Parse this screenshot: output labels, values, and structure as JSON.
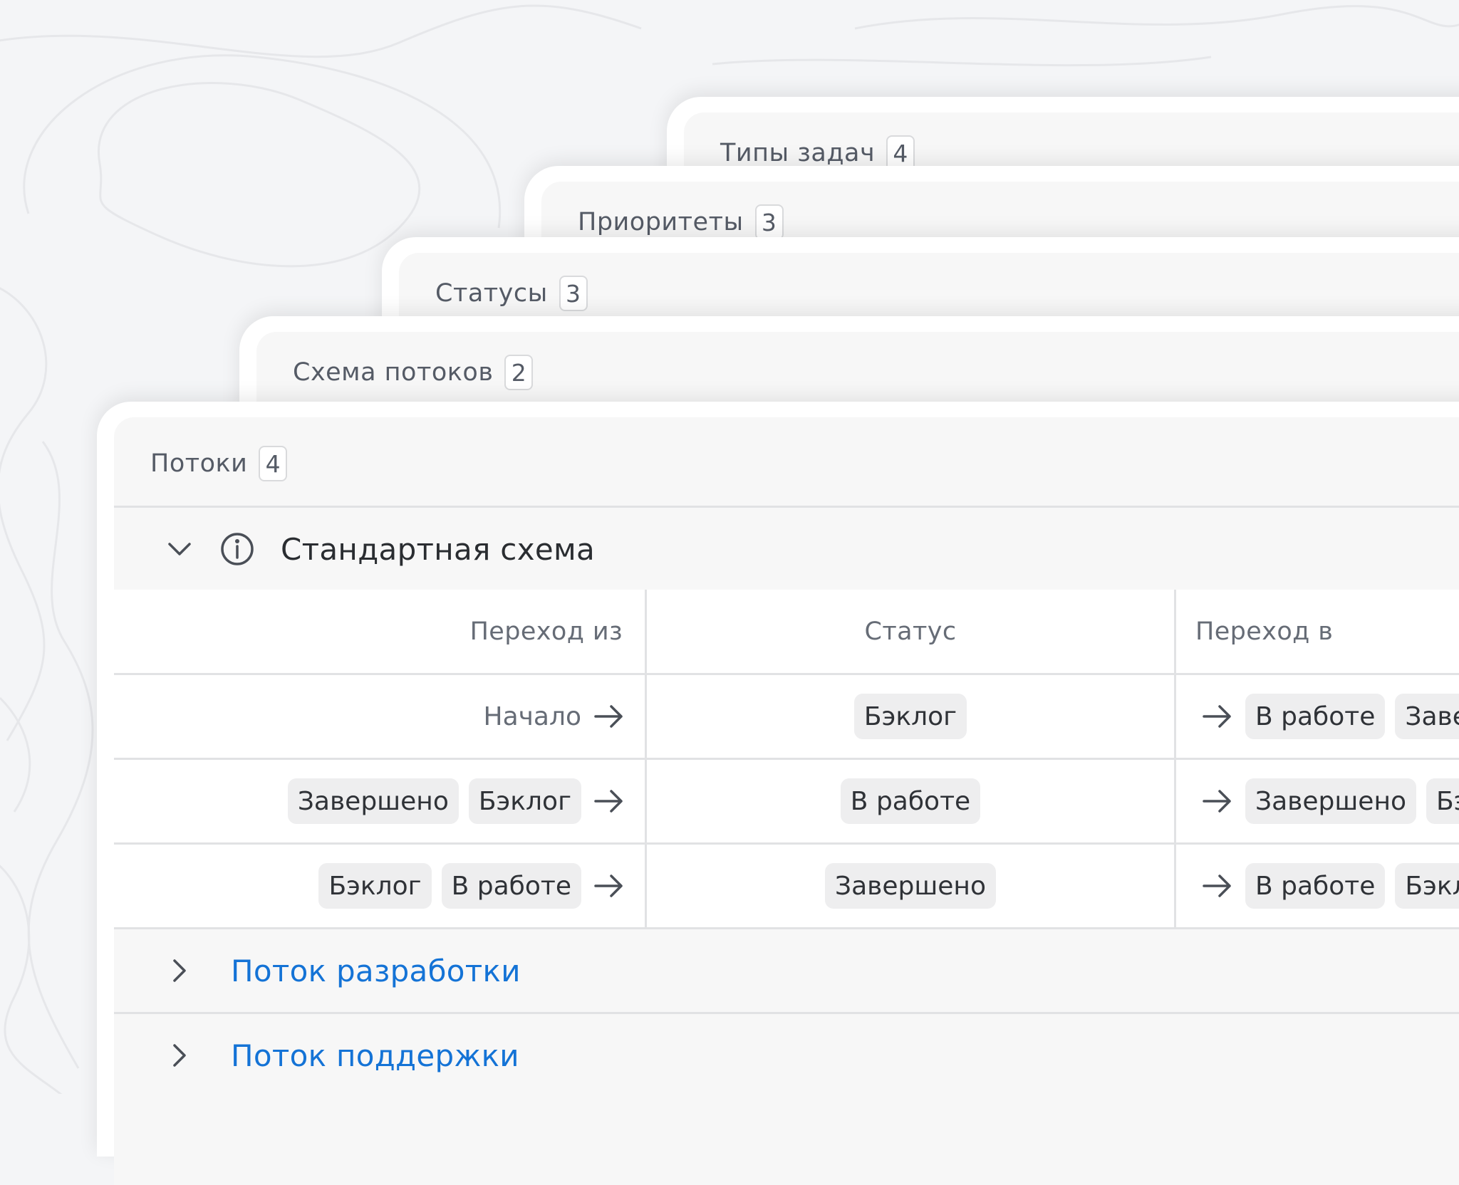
{
  "cards": {
    "task_types": {
      "title": "Типы задач",
      "count": "4"
    },
    "priorities": {
      "title": "Приоритеты",
      "count": "3"
    },
    "statuses": {
      "title": "Статусы",
      "count": "3"
    },
    "flow_schema": {
      "title": "Схема потоков",
      "count": "2"
    },
    "flows": {
      "title": "Потоки",
      "count": "4"
    }
  },
  "flows": {
    "expanded": {
      "title": "Стандартная схема",
      "columns": {
        "from": "Переход из",
        "status": "Статус",
        "to": "Переход в"
      },
      "rows": [
        {
          "from": [
            "Начало"
          ],
          "from_is_plain": true,
          "status": "Бэклог",
          "to": [
            "В работе",
            "Заверш"
          ]
        },
        {
          "from": [
            "Завершено",
            "Бэклог"
          ],
          "status": "В работе",
          "to": [
            "Завершено",
            "Бэ"
          ]
        },
        {
          "from": [
            "Бэклог",
            "В работе"
          ],
          "status": "Завершено",
          "to": [
            "В работе",
            "Бэкл"
          ]
        }
      ]
    },
    "collapsed": [
      {
        "title": "Поток разработки"
      },
      {
        "title": "Поток поддержки"
      }
    ]
  },
  "icons": {
    "expand": "chevron-down-icon",
    "collapse": "chevron-right-icon",
    "info": "info-icon",
    "transition": "arrow-right-icon"
  },
  "colors": {
    "link": "#1473d6",
    "chip": "#eeeeef",
    "background": "#f4f5f7"
  }
}
